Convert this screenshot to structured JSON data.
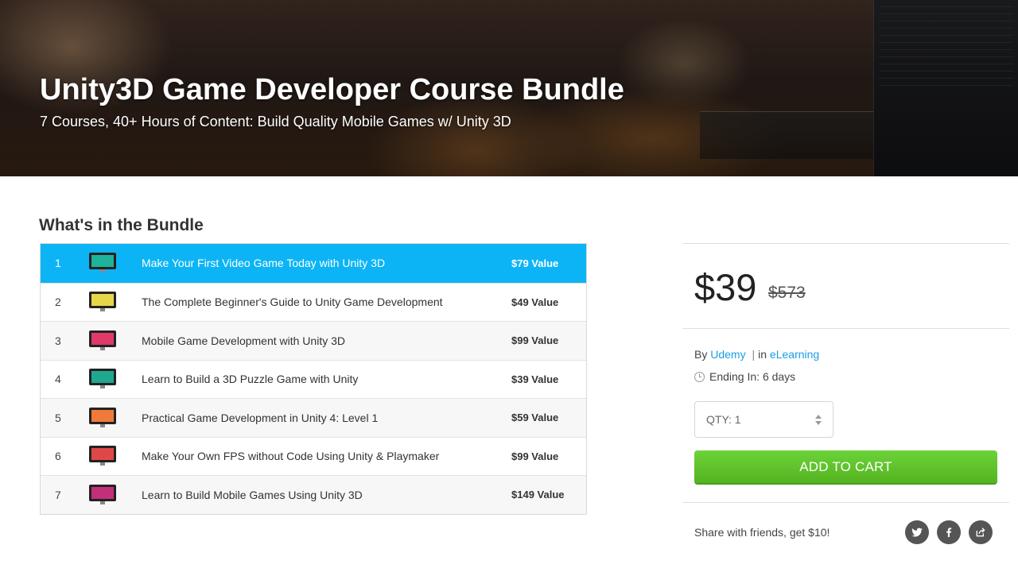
{
  "hero": {
    "title": "Unity3D Game Developer Course Bundle",
    "subtitle": "7 Courses, 40+ Hours of Content: Build Quality Mobile Games w/ Unity 3D"
  },
  "bundle": {
    "heading": "What's in the Bundle",
    "items": [
      {
        "num": "1",
        "title": "Make Your First Video Game Today with Unity 3D",
        "value": "$79 Value",
        "thumb_color": "#1fb39a"
      },
      {
        "num": "2",
        "title": "The Complete Beginner's Guide to Unity Game Development",
        "value": "$49 Value",
        "thumb_color": "#e8d64a"
      },
      {
        "num": "3",
        "title": "Mobile Game Development with Unity 3D",
        "value": "$99 Value",
        "thumb_color": "#e03a6a"
      },
      {
        "num": "4",
        "title": "Learn to Build a 3D Puzzle Game with Unity",
        "value": "$39 Value",
        "thumb_color": "#1fa890"
      },
      {
        "num": "5",
        "title": "Practical Game Development in Unity 4: Level 1",
        "value": "$59 Value",
        "thumb_color": "#f07a3a"
      },
      {
        "num": "6",
        "title": "Make Your Own FPS without Code Using Unity & Playmaker",
        "value": "$99 Value",
        "thumb_color": "#e04848"
      },
      {
        "num": "7",
        "title": "Learn to Build Mobile Games Using Unity 3D",
        "value": "$149 Value",
        "thumb_color": "#c2307a"
      }
    ]
  },
  "purchase": {
    "price": "$39",
    "old_price": "$573",
    "by_label": "By",
    "vendor": "Udemy",
    "separator": "|",
    "in_label": "in",
    "category": "eLearning",
    "ending": "Ending In: 6 days",
    "qty_label": "QTY: 1",
    "cart_label": "ADD TO CART",
    "share_text": "Share with friends, get $10!"
  },
  "colors": {
    "active_row": "#0cb4f5",
    "link": "#1a9ee6",
    "cart_green": "#5cbf2a"
  },
  "icons": [
    "twitter-icon",
    "facebook-icon",
    "share-icon",
    "clock-icon",
    "monitor-icon"
  ]
}
